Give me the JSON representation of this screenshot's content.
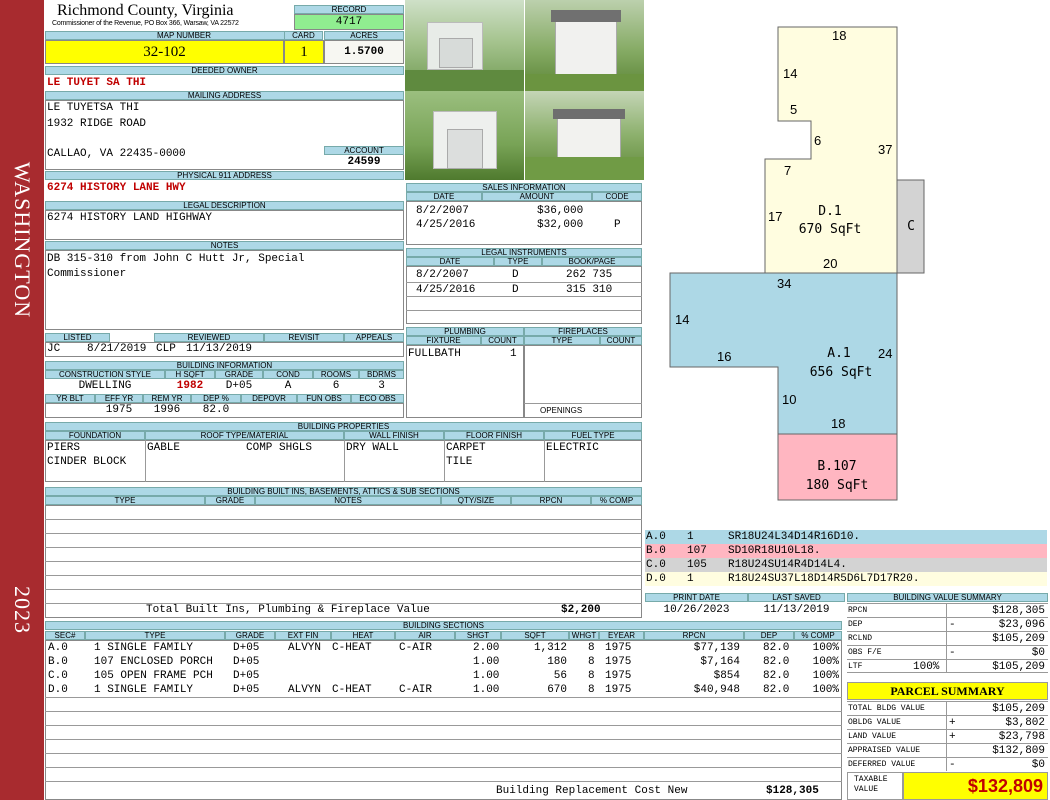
{
  "sidebar": {
    "district": "WASHINGTON",
    "year": "2023"
  },
  "header": {
    "county": "Richmond County, Virginia",
    "commissioner": "Commissioner of the Revenue, PO Box 366, Warsaw, VA 22572",
    "record_label": "RECORD",
    "record": "4717",
    "map_label": "MAP NUMBER",
    "map_number": "32-102",
    "card_label": "CARD",
    "card": "1",
    "acres_label": "ACRES",
    "acres": "1.5700"
  },
  "owner": {
    "deeded_label": "DEEDED OWNER",
    "deeded_owner": "LE TUYET SA THI",
    "mailing_label": "MAILING ADDRESS",
    "mailing_lines": [
      "LE TUYETSA THI",
      "1932 RIDGE ROAD",
      "",
      "CALLAO, VA 22435-0000"
    ],
    "account_label": "ACCOUNT",
    "account": "24599",
    "physical_label": "PHYSICAL 911 ADDRESS",
    "physical": "6274 HISTORY LANE HWY",
    "legal_label": "LEGAL DESCRIPTION",
    "legal": "6274 HISTORY LAND HIGHWAY",
    "notes_label": "NOTES",
    "notes_lines": [
      "DB 315-310 from John C Hutt Jr, Special",
      "Commissioner"
    ]
  },
  "sales": {
    "title": "SALES INFORMATION",
    "headers": [
      "DATE",
      "AMOUNT",
      "CODE"
    ],
    "rows": [
      [
        "8/2/2007",
        "$36,000",
        ""
      ],
      [
        "4/25/2016",
        "$32,000",
        "P"
      ]
    ]
  },
  "legal_instruments": {
    "title": "LEGAL INSTRUMENTS",
    "headers": [
      "DATE",
      "TYPE",
      "BOOK/PAGE"
    ],
    "rows": [
      [
        "8/2/2007",
        "D",
        "262 735"
      ],
      [
        "4/25/2016",
        "D",
        "315 310"
      ]
    ]
  },
  "listing": {
    "headers": [
      "LISTED",
      "REVIEWED",
      "REVISIT",
      "APPEALS"
    ],
    "listed_by": "JC",
    "listed_date": "8/21/2019",
    "reviewed_by": "CLP",
    "reviewed_date": "11/13/2019"
  },
  "building_info": {
    "title": "BUILDING INFORMATION",
    "headers1": [
      "CONSTRUCTION STYLE",
      "H SQFT",
      "GRADE",
      "COND",
      "ROOMS",
      "BDRMS"
    ],
    "values1": [
      "DWELLING",
      "1982",
      "D+05",
      "A",
      "6",
      "3"
    ],
    "headers2": [
      "YR BLT",
      "EFF YR",
      "REM YR",
      "DEP %",
      "DEPOVR",
      "FUN OBS",
      "ECO OBS"
    ],
    "values2": [
      "",
      "1975",
      "1996",
      "82.0",
      "",
      "",
      ""
    ]
  },
  "plumbing": {
    "title": "PLUMBING",
    "headers": [
      "FIXTURE",
      "COUNT"
    ],
    "rows": [
      [
        "FULLBATH",
        "1"
      ]
    ]
  },
  "fireplaces": {
    "title": "FIREPLACES",
    "headers": [
      "TYPE",
      "COUNT"
    ],
    "openings_label": "OPENINGS"
  },
  "properties": {
    "title": "BUILDING PROPERTIES",
    "headers": [
      "FOUNDATION",
      "ROOF TYPE/MATERIAL",
      "WALL FINISH",
      "FLOOR FINISH",
      "FUEL TYPE"
    ],
    "foundation": [
      "PIERS",
      "CINDER BLOCK"
    ],
    "roof_type": "GABLE",
    "roof_material": "COMP SHGLS",
    "wall": "DRY WALL",
    "floor": [
      "CARPET",
      "TILE"
    ],
    "fuel": "ELECTRIC"
  },
  "built_ins": {
    "title": "BUILDING BUILT INS, BASEMENTS, ATTICS & SUB SECTIONS",
    "headers": [
      "TYPE",
      "GRADE",
      "NOTES",
      "QTY/SIZE",
      "RPCN",
      "% COMP"
    ],
    "total_label": "Total Built Ins, Plumbing & Fireplace Value",
    "total_value": "$2,200"
  },
  "print_info": {
    "print_label": "PRINT DATE",
    "print_date": "10/26/2023",
    "saved_label": "LAST SAVED",
    "saved_date": "11/13/2019"
  },
  "sections": {
    "title": "BUILDING SECTIONS",
    "headers": [
      "SEC#",
      "TYPE",
      "GRADE",
      "EXT FIN",
      "HEAT",
      "AIR",
      "SHGT",
      "SQFT",
      "WHGT",
      "EYEAR",
      "RPCN",
      "DEP",
      "% COMP"
    ],
    "rows": [
      [
        "A.0",
        "1 SINGLE FAMILY",
        "D+05",
        "ALVYN",
        "C-HEAT",
        "C-AIR",
        "2.00",
        "1,312",
        "8",
        "1975",
        "$77,139",
        "82.0",
        "100%"
      ],
      [
        "B.0",
        "107 ENCLOSED PORCH",
        "D+05",
        "",
        "",
        "",
        "1.00",
        "180",
        "8",
        "1975",
        "$7,164",
        "82.0",
        "100%"
      ],
      [
        "C.0",
        "105 OPEN FRAME PCH",
        "D+05",
        "",
        "",
        "",
        "1.00",
        "56",
        "8",
        "1975",
        "$854",
        "82.0",
        "100%"
      ],
      [
        "D.0",
        "1 SINGLE FAMILY",
        "D+05",
        "ALVYN",
        "C-HEAT",
        "C-AIR",
        "1.00",
        "670",
        "8",
        "1975",
        "$40,948",
        "82.0",
        "100%"
      ]
    ],
    "replacement_label": "Building Replacement Cost New",
    "replacement_value": "$128,305"
  },
  "sketch": {
    "d_label": "D.1",
    "d_area": "670 SqFt",
    "a_label": "A.1",
    "a_area": "656 SqFt",
    "b_label": "B.107",
    "b_area": "180 SqFt",
    "c_label": "C",
    "dims": [
      "18",
      "14",
      "5",
      "6",
      "37",
      "7",
      "17",
      "20",
      "34",
      "14",
      "16",
      "24",
      "10",
      "18"
    ],
    "colors": {
      "d": "#fffde0",
      "a": "#add8e6",
      "b": "#ffb6c1",
      "c": "#d3d3d3"
    }
  },
  "codes": [
    {
      "sec": "A.0",
      "num": "1",
      "code": "SR18U24L34D14R16D10.",
      "color": "#add8e6"
    },
    {
      "sec": "B.0",
      "num": "107",
      "code": "SD10R18U10L18.",
      "color": "#ffb6c1"
    },
    {
      "sec": "C.0",
      "num": "105",
      "code": "R18U24SU14R4D14L4.",
      "color": "#d3d3d3"
    },
    {
      "sec": "D.0",
      "num": "1",
      "code": "R18U24SU37L18D14R5D6L7D17R20.",
      "color": "#fffde0"
    }
  ],
  "value_summary": {
    "title": "BUILDING VALUE SUMMARY",
    "rows": [
      {
        "label": "RPCN",
        "sign": "",
        "value": "$128,305"
      },
      {
        "label": "DEP",
        "sign": "-",
        "value": "$23,096"
      },
      {
        "label": "RCLND",
        "sign": "",
        "value": "$105,209"
      },
      {
        "label": "OBS F/E",
        "sign": "-",
        "value": "$0"
      },
      {
        "label": "LTF",
        "sign": "100%",
        "value": "$105,209"
      }
    ]
  },
  "parcel_summary": {
    "title": "PARCEL SUMMARY",
    "rows": [
      {
        "label": "TOTAL BLDG VALUE",
        "sign": "",
        "value": "$105,209"
      },
      {
        "label": "OBLDG VALUE",
        "sign": "+",
        "value": "$3,802"
      },
      {
        "label": "LAND VALUE",
        "sign": "+",
        "value": "$23,798"
      },
      {
        "label": "APPRAISED VALUE",
        "sign": "",
        "value": "$132,809"
      },
      {
        "label": "DEFERRED VALUE",
        "sign": "-",
        "value": "$0"
      }
    ],
    "taxable_label_1": "TAXABLE",
    "taxable_label_2": "VALUE",
    "taxable_value": "$132,809"
  }
}
